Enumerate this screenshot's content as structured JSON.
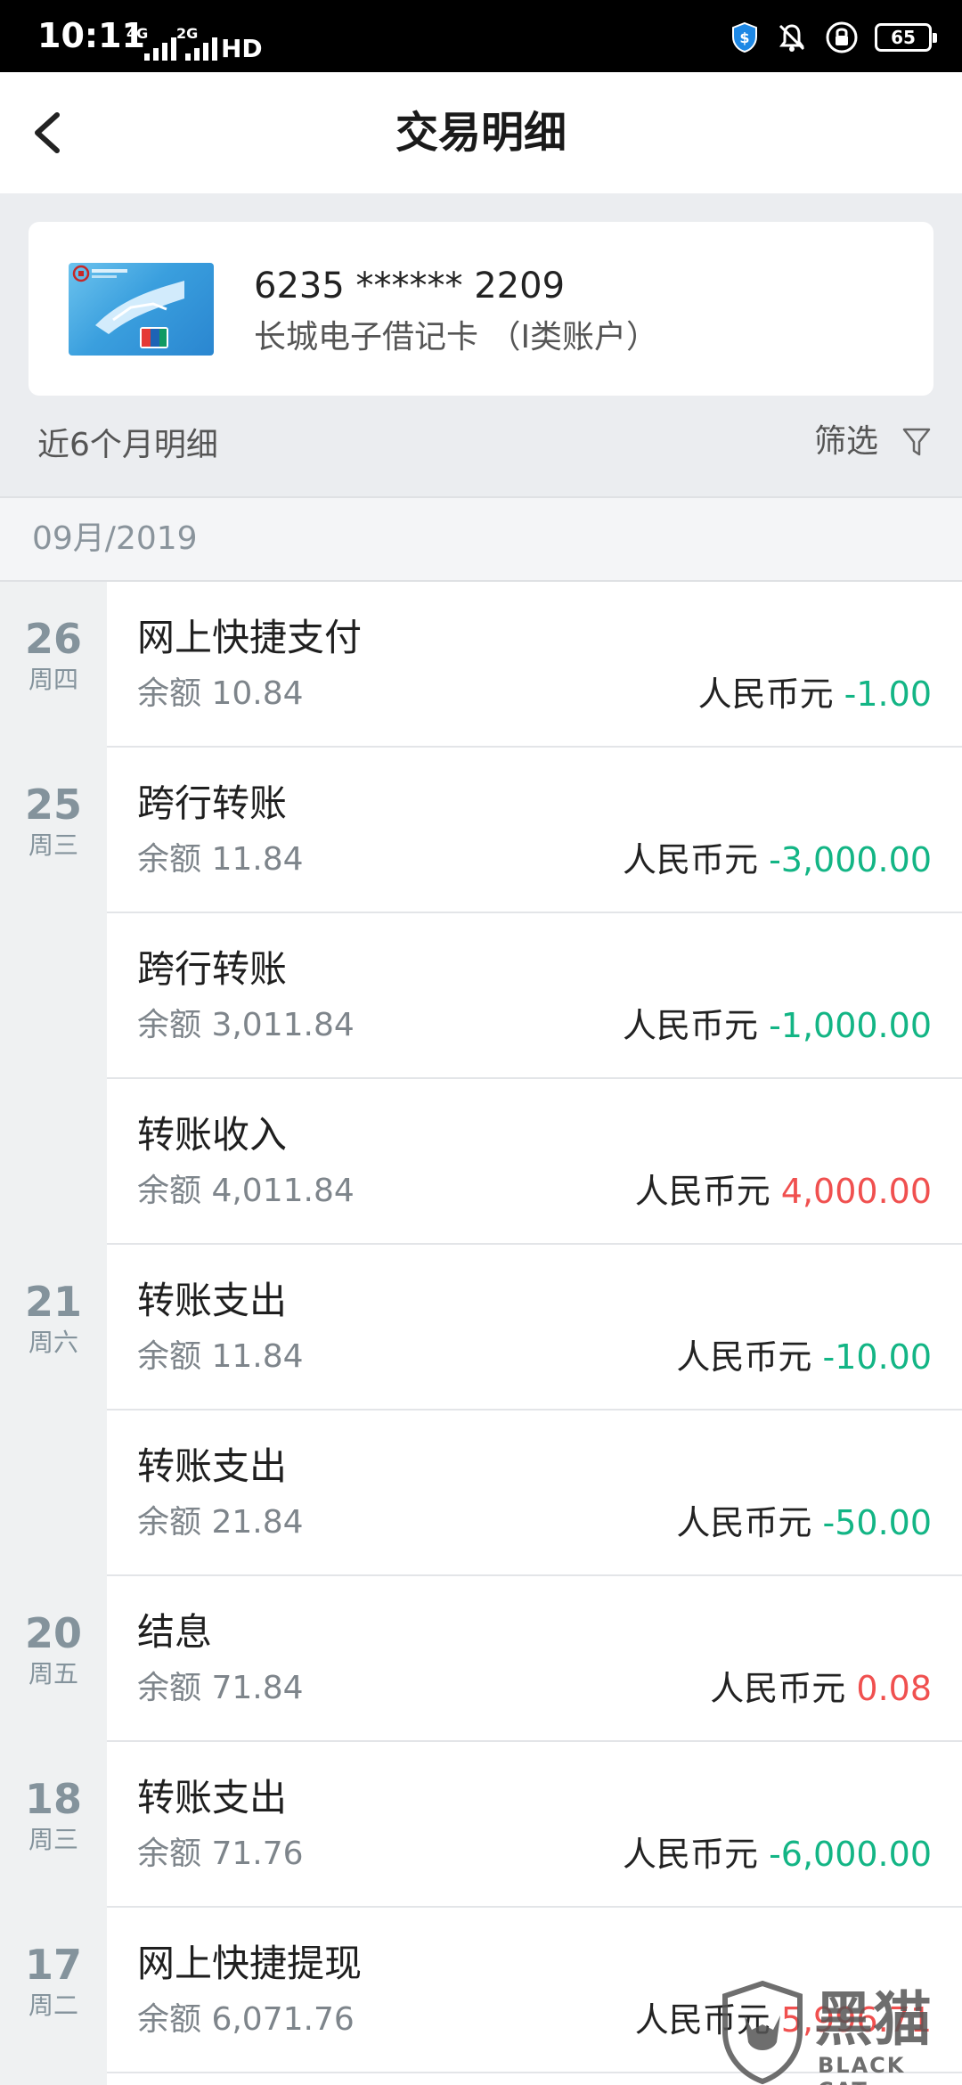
{
  "status_bar": {
    "time": "10:11",
    "signal_1": "4G",
    "signal_2": "2G",
    "network": "HD",
    "battery": "65"
  },
  "header": {
    "title": "交易明细"
  },
  "card": {
    "number": "6235 ****** 2209",
    "type": "长城电子借记卡 （I类账户）"
  },
  "filter_bar": {
    "period_label": "近6个月明细",
    "filter_label": "筛选"
  },
  "month": "09月/2019",
  "days": [
    {
      "day": "26",
      "weekday": "周四"
    },
    {
      "day": "25",
      "weekday": "周三"
    },
    {
      "day": "21",
      "weekday": "周六"
    },
    {
      "day": "20",
      "weekday": "周五"
    },
    {
      "day": "18",
      "weekday": "周三"
    },
    {
      "day": "17",
      "weekday": "周二"
    }
  ],
  "transactions": [
    {
      "name": "网上快捷支付",
      "balance": "余额 10.84",
      "currency": "人民币元 ",
      "amount": "-1.00"
    },
    {
      "name": "跨行转账",
      "balance": "余额 11.84",
      "currency": "人民币元 ",
      "amount": "-3,000.00"
    },
    {
      "name": "跨行转账",
      "balance": "余额 3,011.84",
      "currency": "人民币元 ",
      "amount": "-1,000.00"
    },
    {
      "name": "转账收入",
      "balance": "余额 4,011.84",
      "currency": "人民币元 ",
      "amount": "4,000.00"
    },
    {
      "name": "转账支出",
      "balance": "余额 11.84",
      "currency": "人民币元 ",
      "amount": "-10.00"
    },
    {
      "name": "转账支出",
      "balance": "余额 21.84",
      "currency": "人民币元 ",
      "amount": "-50.00"
    },
    {
      "name": "结息",
      "balance": "余额 71.84",
      "currency": "人民币元 ",
      "amount": "0.08"
    },
    {
      "name": "转账支出",
      "balance": "余额 71.76",
      "currency": "人民币元 ",
      "amount": "-6,000.00"
    },
    {
      "name": "网上快捷提现",
      "balance": "余额 6,071.76",
      "currency": "人民币元 ",
      "amount": "5,996.71"
    }
  ],
  "watermark": {
    "text": "黑猫",
    "sub": "BLACK CAT"
  },
  "colors": {
    "debit": "#13b585",
    "credit": "#f0504f",
    "background_gray": "#ebedf0"
  }
}
